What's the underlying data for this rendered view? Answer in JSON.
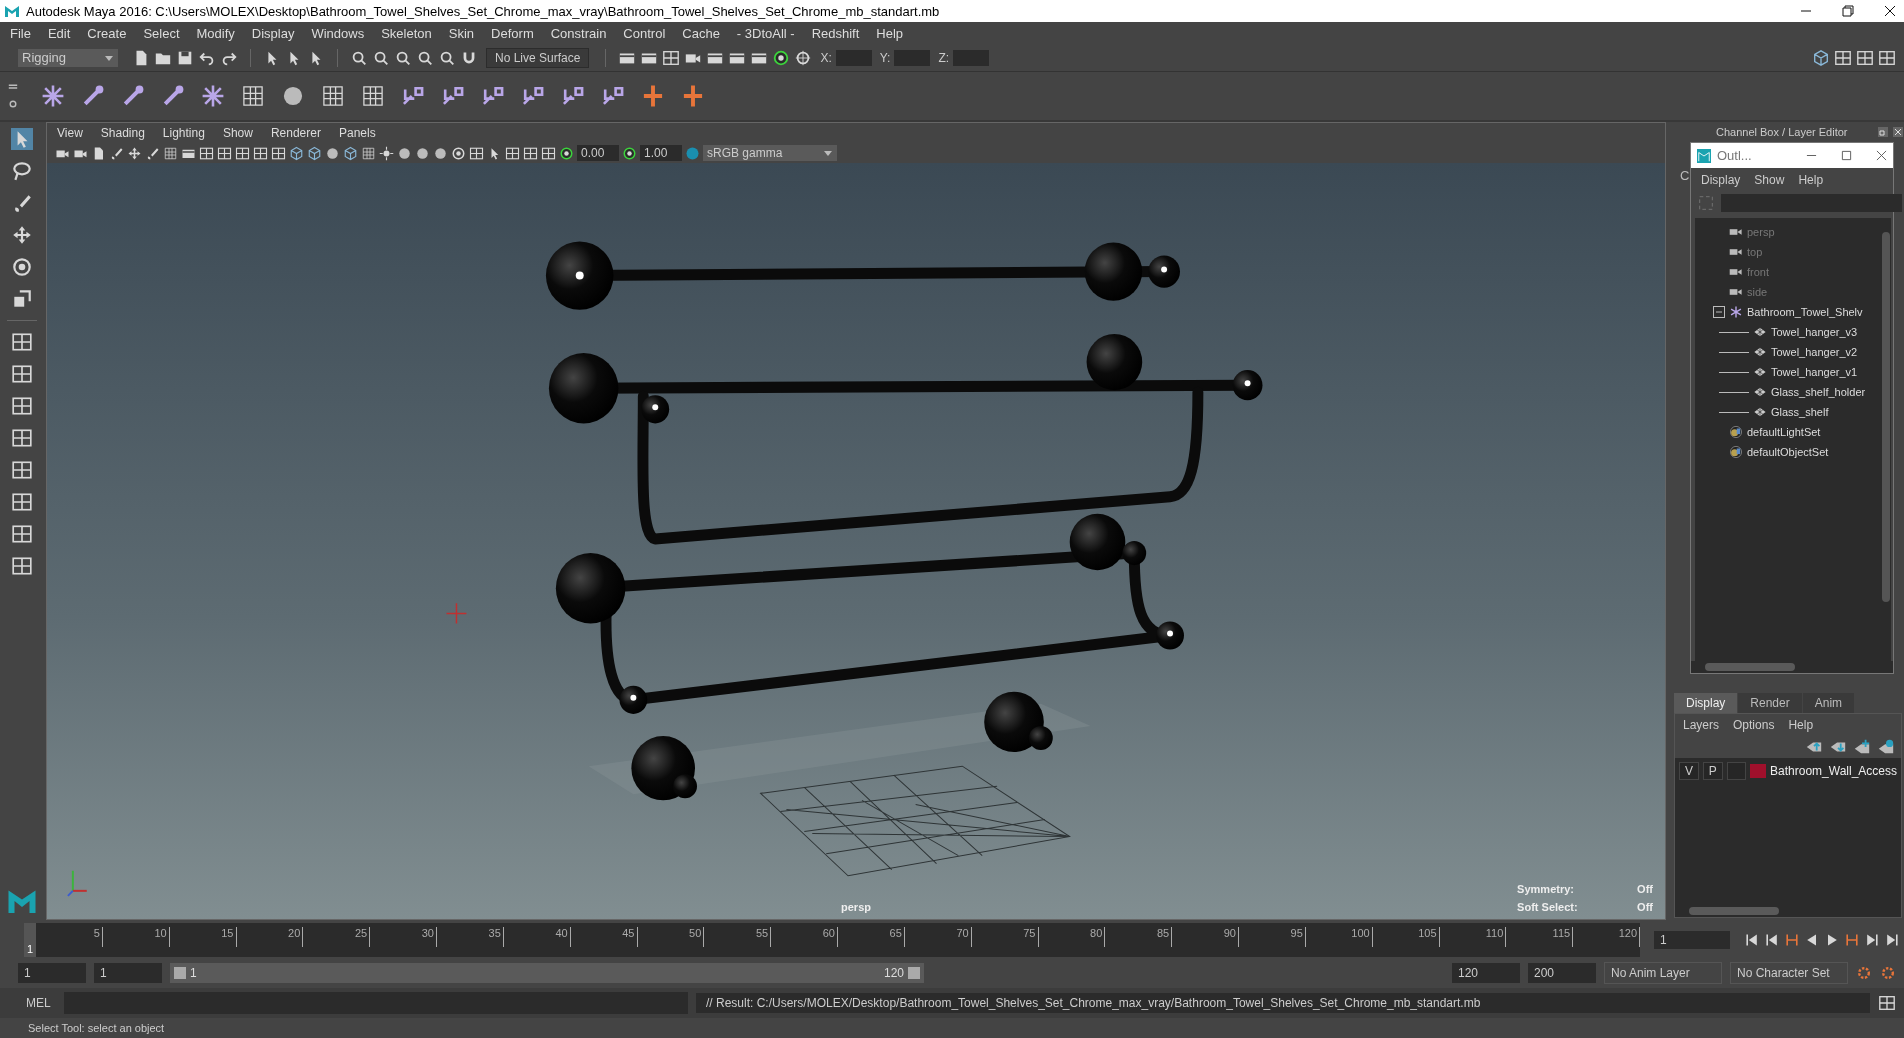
{
  "window": {
    "title": "Autodesk Maya 2016: C:\\Users\\MOLEX\\Desktop\\Bathroom_Towel_Shelves_Set_Chrome_max_vray\\Bathroom_Towel_Shelves_Set_Chrome_mb_standart.mb"
  },
  "menu_bar": [
    "File",
    "Edit",
    "Create",
    "Select",
    "Modify",
    "Display",
    "Windows",
    "Skeleton",
    "Skin",
    "Deform",
    "Constrain",
    "Control",
    "Cache",
    "- 3DtoAll -",
    "Redshift",
    "Help"
  ],
  "status_line": {
    "menu_set": "Rigging",
    "live_surface": "No Live Surface",
    "coords": [
      {
        "label": "X:"
      },
      {
        "label": "Y:"
      },
      {
        "label": "Z:"
      }
    ]
  },
  "viewport": {
    "menu": [
      "View",
      "Shading",
      "Lighting",
      "Show",
      "Renderer",
      "Panels"
    ],
    "exposure": "0.00",
    "gamma": "1.00",
    "color_space": "sRGB gamma",
    "camera": "persp",
    "hud": [
      {
        "label": "Symmetry:",
        "value": "Off"
      },
      {
        "label": "Soft Select:",
        "value": "Off"
      }
    ]
  },
  "channel_box": {
    "title": "Channel Box / Layer Editor",
    "tab": "C"
  },
  "outliner": {
    "title": "Outl...",
    "menu": [
      "Display",
      "Show",
      "Help"
    ],
    "items": [
      {
        "name": "persp",
        "kind": "camera"
      },
      {
        "name": "top",
        "kind": "camera"
      },
      {
        "name": "front",
        "kind": "camera"
      },
      {
        "name": "side",
        "kind": "camera"
      },
      {
        "name": "Bathroom_Towel_Shelv",
        "kind": "group",
        "expanded": true,
        "children": [
          {
            "name": "Towel_hanger_v3",
            "kind": "mesh"
          },
          {
            "name": "Towel_hanger_v2",
            "kind": "mesh"
          },
          {
            "name": "Towel_hanger_v1",
            "kind": "mesh"
          },
          {
            "name": "Glass_shelf_holder",
            "kind": "mesh"
          },
          {
            "name": "Glass_shelf",
            "kind": "mesh"
          }
        ]
      },
      {
        "name": "defaultLightSet",
        "kind": "set"
      },
      {
        "name": "defaultObjectSet",
        "kind": "set"
      }
    ]
  },
  "layer_editor": {
    "tabs": [
      {
        "label": "Display",
        "selected": true
      },
      {
        "label": "Render",
        "selected": false
      },
      {
        "label": "Anim",
        "selected": false
      }
    ],
    "menu": [
      "Layers",
      "Options",
      "Help"
    ],
    "layers": [
      {
        "visible": "V",
        "playback": "P",
        "color": "#a0102c",
        "name": "Bathroom_Wall_Access"
      }
    ]
  },
  "time_slider": {
    "current": "1",
    "ticks": [
      "5",
      "10",
      "15",
      "20",
      "25",
      "30",
      "35",
      "40",
      "45",
      "50",
      "55",
      "60",
      "65",
      "70",
      "75",
      "80",
      "85",
      "90",
      "95",
      "100",
      "105",
      "110",
      "115",
      "120"
    ],
    "frame_field": "1"
  },
  "range_slider": {
    "level": 1,
    "start": "1",
    "playback_start": "1",
    "range_start": "1",
    "range_end": "120",
    "playback_end": "120",
    "end": "200",
    "anim_layer": "No Anim Layer",
    "character_set": "No Character Set"
  },
  "command_line": {
    "language": "MEL",
    "result": "// Result: C:/Users/MOLEX/Desktop/Bathroom_Towel_Shelves_Set_Chrome_max_vray/Bathroom_Towel_Shelves_Set_Chrome_mb_standart.mb"
  },
  "help_line": "Select Tool: select an object"
}
